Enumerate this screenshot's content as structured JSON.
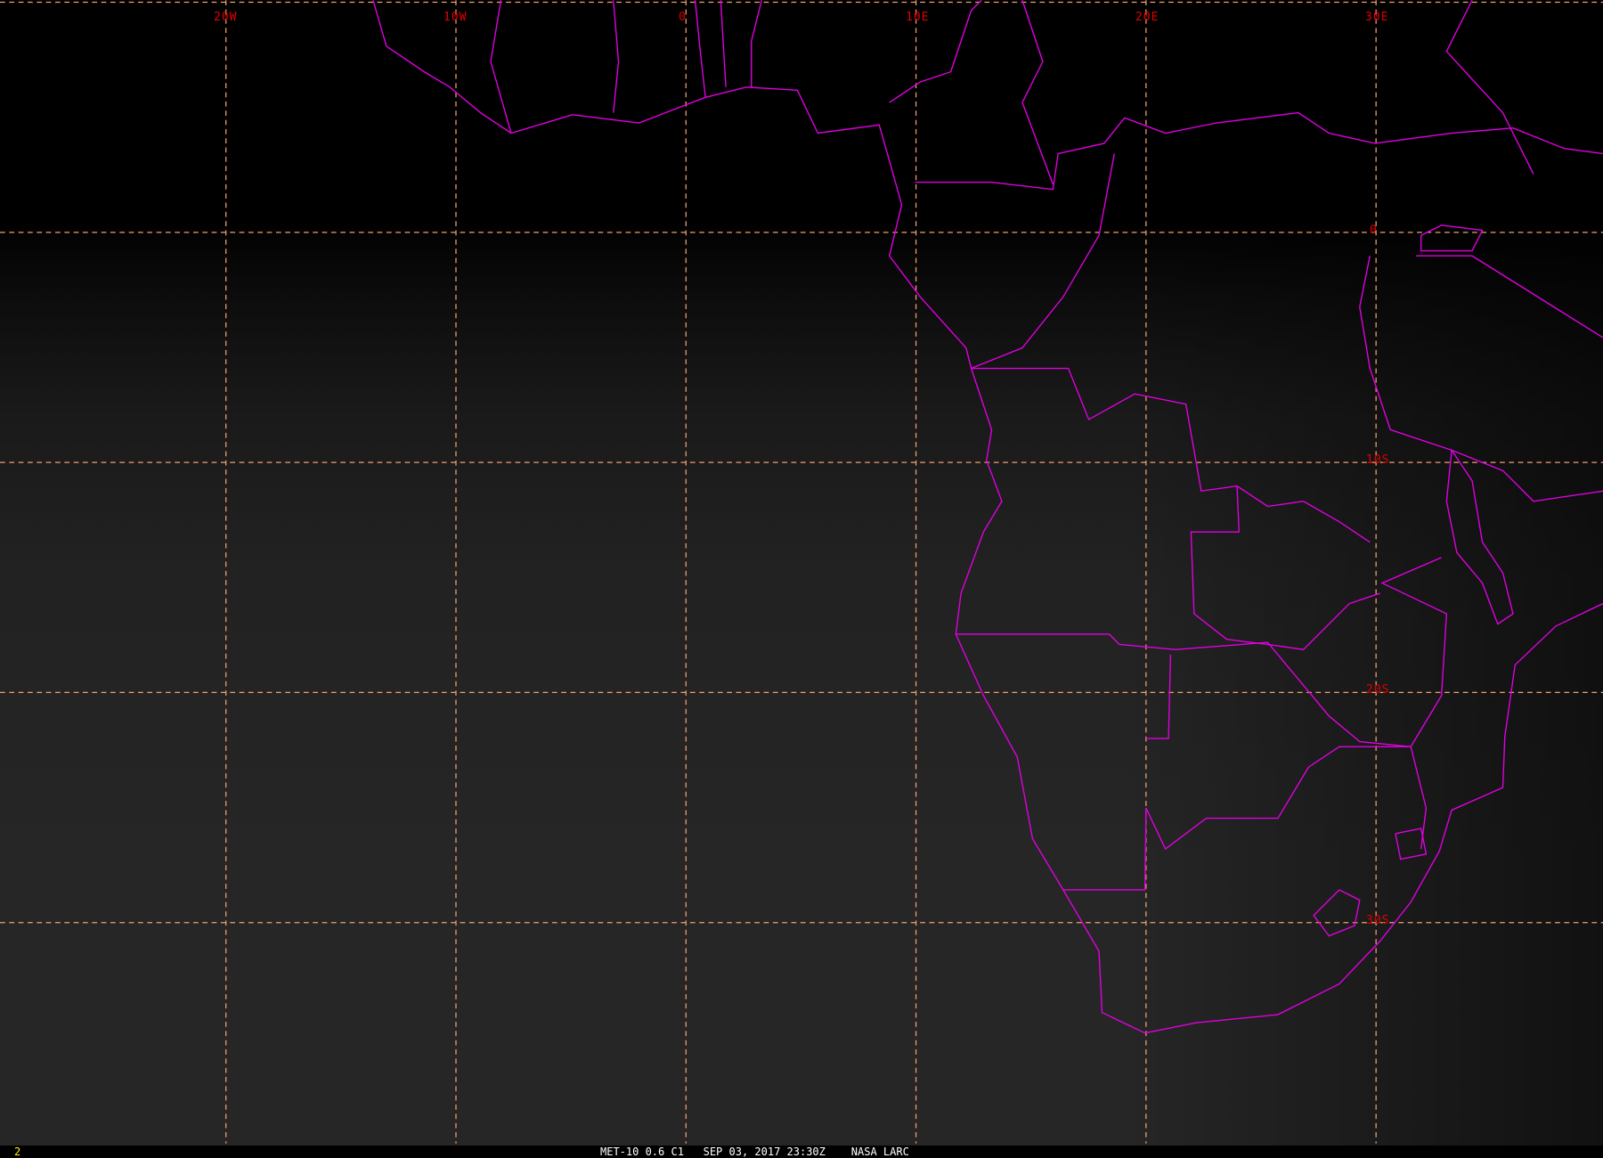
{
  "map": {
    "longitude_labels": [
      "20W",
      "10W",
      "0",
      "10E",
      "20E",
      "30E"
    ],
    "latitude_labels": [
      "0",
      "10S",
      "20S",
      "30S"
    ],
    "grid_color": "#f0a070",
    "border_color": "#e000e0",
    "label_color": "#e00000"
  },
  "footer": {
    "frame_number": "2",
    "satellite_channel": "MET-10 0.6 C1",
    "datetime": "SEP 03, 2017 23:30Z",
    "source": "NASA LARC"
  }
}
